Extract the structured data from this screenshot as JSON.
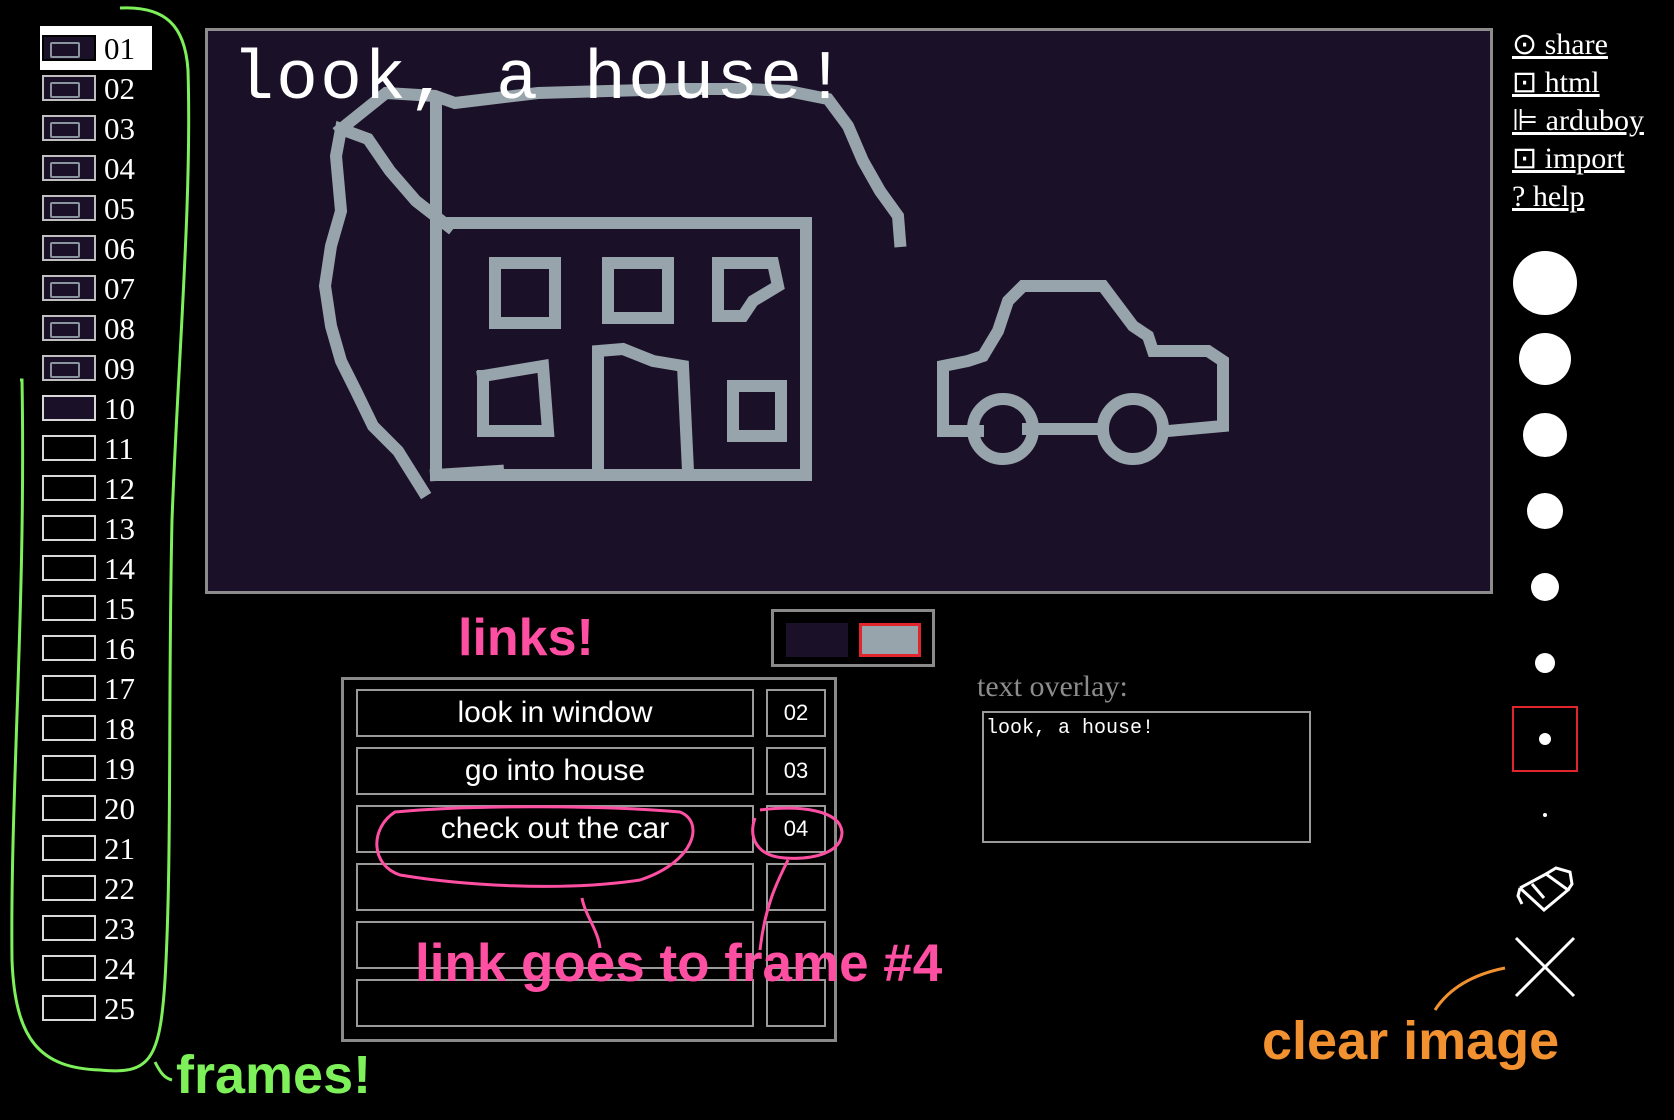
{
  "frames": [
    {
      "num": "01",
      "selected": true,
      "thumb": "filled"
    },
    {
      "num": "02",
      "thumb": "filled"
    },
    {
      "num": "03",
      "thumb": "filled"
    },
    {
      "num": "04",
      "thumb": "filled"
    },
    {
      "num": "05",
      "thumb": "filled"
    },
    {
      "num": "06",
      "thumb": "filled"
    },
    {
      "num": "07",
      "thumb": "filled"
    },
    {
      "num": "08",
      "thumb": "filled"
    },
    {
      "num": "09",
      "thumb": "filled"
    },
    {
      "num": "10",
      "thumb": "dark"
    },
    {
      "num": "11",
      "thumb": "empty"
    },
    {
      "num": "12",
      "thumb": "empty"
    },
    {
      "num": "13",
      "thumb": "empty"
    },
    {
      "num": "14",
      "thumb": "empty"
    },
    {
      "num": "15",
      "thumb": "empty"
    },
    {
      "num": "16",
      "thumb": "empty"
    },
    {
      "num": "17",
      "thumb": "empty"
    },
    {
      "num": "18",
      "thumb": "empty"
    },
    {
      "num": "19",
      "thumb": "empty"
    },
    {
      "num": "20",
      "thumb": "empty"
    },
    {
      "num": "21",
      "thumb": "empty"
    },
    {
      "num": "22",
      "thumb": "empty"
    },
    {
      "num": "23",
      "thumb": "empty"
    },
    {
      "num": "24",
      "thumb": "empty"
    },
    {
      "num": "25",
      "thumb": "empty"
    }
  ],
  "canvas": {
    "overlay_text": "look, a house!",
    "background_color": "#1a1128",
    "line_color": "#98a4ab"
  },
  "menu": [
    {
      "icon": "target-icon",
      "label": "⊙ share"
    },
    {
      "icon": "box-icon",
      "label": "⊡ html"
    },
    {
      "icon": "bars-icon",
      "label": "⊫ arduboy"
    },
    {
      "icon": "box-icon",
      "label": "⊡ import"
    },
    {
      "icon": "question-icon",
      "label": "? help"
    }
  ],
  "brushes": {
    "sizes_descending": 8,
    "selected_index": 6,
    "tools": [
      "fill-bucket-icon",
      "clear-x-icon"
    ]
  },
  "colors": {
    "swatch_dark": "#1a1128",
    "swatch_light": "#98a4ab",
    "selected_swatch": "light",
    "selection_outline": "#e0262c"
  },
  "links": [
    {
      "text": "look in window",
      "target": "02"
    },
    {
      "text": "go into house",
      "target": "03"
    },
    {
      "text": "check out the car",
      "target": "04"
    },
    {
      "text": "",
      "target": ""
    },
    {
      "text": "",
      "target": ""
    },
    {
      "text": "",
      "target": ""
    }
  ],
  "text_overlay": {
    "label": "text overlay:",
    "value": "look, a house!"
  },
  "annotations": {
    "links": "links!",
    "link_goes": "link goes to frame #4",
    "frames": "frames!",
    "clear": "clear image",
    "colors": {
      "pink": "#ff4fa3",
      "green": "#7df05a",
      "orange": "#f29130"
    }
  }
}
